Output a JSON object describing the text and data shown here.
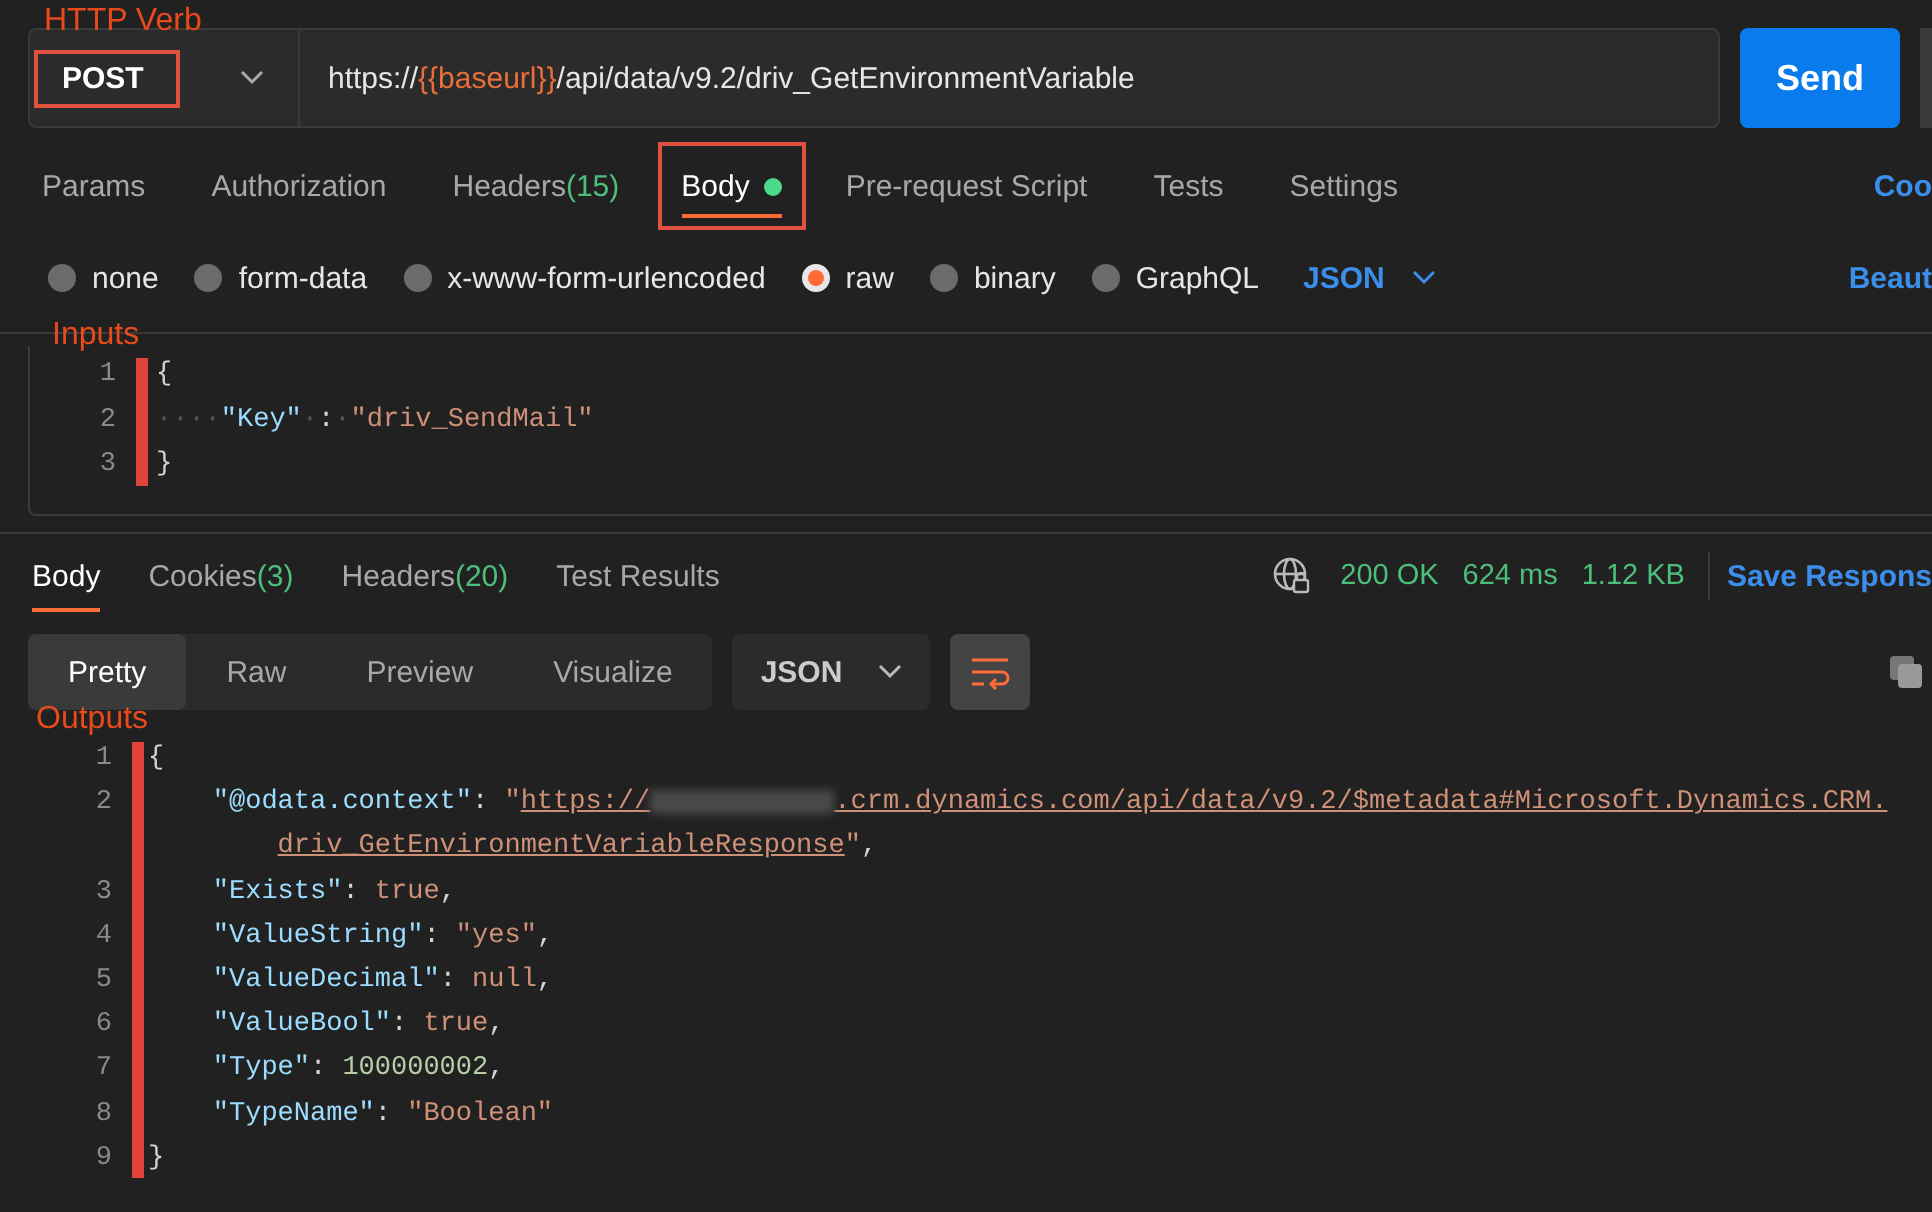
{
  "annotations": [
    {
      "text": "HTTP Verb"
    },
    {
      "text": "Inputs"
    },
    {
      "text": "Outputs"
    }
  ],
  "request": {
    "method": {
      "label": "POST",
      "highlighted": true
    },
    "url": [
      {
        "kind": "text",
        "text": "https://"
      },
      {
        "kind": "variable",
        "text": "{{baseurl}}"
      },
      {
        "kind": "text",
        "text": "/api/data/v9.2/driv_GetEnvironmentVariable"
      }
    ],
    "send_button": "Send"
  },
  "request_tabs": [
    {
      "label": "Params",
      "selected": false,
      "highlighted": false
    },
    {
      "label": "Authorization",
      "selected": false,
      "highlighted": false
    },
    {
      "label": "Headers",
      "count": "(15)",
      "selected": false,
      "highlighted": false
    },
    {
      "label": "Body",
      "selected": true,
      "highlighted": true,
      "dot": true
    },
    {
      "label": "Pre-request Script",
      "selected": false,
      "highlighted": false
    },
    {
      "label": "Tests",
      "selected": false,
      "highlighted": false
    },
    {
      "label": "Settings",
      "selected": false,
      "highlighted": false
    }
  ],
  "cookies_link": "Coo",
  "body_types": [
    {
      "label": "none",
      "selected": false
    },
    {
      "label": "form-data",
      "selected": false
    },
    {
      "label": "x-www-form-urlencoded",
      "selected": false
    },
    {
      "label": "raw",
      "selected": true
    },
    {
      "label": "binary",
      "selected": false
    },
    {
      "label": "GraphQL",
      "selected": false
    }
  ],
  "body_format": "JSON",
  "beautify_link": "Beaut",
  "request_body": [
    {
      "number": "1",
      "tokens": [
        {
          "kind": "punct",
          "text": "{"
        }
      ]
    },
    {
      "number": "2",
      "tokens": [
        {
          "kind": "indent",
          "text": "····"
        },
        {
          "kind": "key",
          "text": "\"Key\""
        },
        {
          "kind": "indent",
          "text": "·"
        },
        {
          "kind": "punct",
          "text": ":"
        },
        {
          "kind": "indent",
          "text": "·"
        },
        {
          "kind": "string",
          "text": "\"driv_SendMail\""
        }
      ]
    },
    {
      "number": "3",
      "tokens": [
        {
          "kind": "punct",
          "text": "}"
        }
      ]
    }
  ],
  "response_tabs": [
    {
      "label": "Body",
      "selected": true
    },
    {
      "label": "Cookies",
      "count": "(3)",
      "selected": false
    },
    {
      "label": "Headers",
      "count": "(20)",
      "selected": false
    },
    {
      "label": "Test Results",
      "selected": false
    }
  ],
  "status": {
    "code": "200 OK",
    "time": "624 ms",
    "size": "1.12 KB"
  },
  "save_response": "Save Respons",
  "view_modes": [
    {
      "label": "Pretty",
      "selected": true
    },
    {
      "label": "Raw",
      "selected": false
    },
    {
      "label": "Preview",
      "selected": false
    },
    {
      "label": "Visualize",
      "selected": false
    }
  ],
  "response_format": "JSON",
  "response_body": [
    {
      "number": "1",
      "tokens": [
        {
          "kind": "punct",
          "text": "{"
        }
      ]
    },
    {
      "number": "2",
      "indented": true,
      "tokens": [
        {
          "kind": "key",
          "text": "\"@odata.context\""
        },
        {
          "kind": "punct",
          "text": ": "
        },
        {
          "kind": "string",
          "text": "\""
        },
        {
          "kind": "link",
          "text": "https://"
        },
        {
          "kind": "redacted"
        },
        {
          "kind": "link",
          "text": ".crm.dynamics.com/api/data/v9.2/$metadata#Microsoft.Dynamics.CRM."
        }
      ]
    },
    {
      "continuation": true,
      "tokens": [
        {
          "kind": "link",
          "text": "driv_GetEnvironmentVariableResponse"
        },
        {
          "kind": "string",
          "text": "\""
        },
        {
          "kind": "punct",
          "text": ","
        }
      ]
    },
    {
      "number": "3",
      "indented": true,
      "tokens": [
        {
          "kind": "key",
          "text": "\"Exists\""
        },
        {
          "kind": "punct",
          "text": ": "
        },
        {
          "kind": "bool",
          "text": "true"
        },
        {
          "kind": "punct",
          "text": ","
        }
      ]
    },
    {
      "number": "4",
      "indented": true,
      "tokens": [
        {
          "kind": "key",
          "text": "\"ValueString\""
        },
        {
          "kind": "punct",
          "text": ": "
        },
        {
          "kind": "string",
          "text": "\"yes\""
        },
        {
          "kind": "punct",
          "text": ","
        }
      ]
    },
    {
      "number": "5",
      "indented": true,
      "tokens": [
        {
          "kind": "key",
          "text": "\"ValueDecimal\""
        },
        {
          "kind": "punct",
          "text": ": "
        },
        {
          "kind": "bool",
          "text": "null"
        },
        {
          "kind": "punct",
          "text": ","
        }
      ]
    },
    {
      "number": "6",
      "indented": true,
      "tokens": [
        {
          "kind": "key",
          "text": "\"ValueBool\""
        },
        {
          "kind": "punct",
          "text": ": "
        },
        {
          "kind": "bool",
          "text": "true"
        },
        {
          "kind": "punct",
          "text": ","
        }
      ]
    },
    {
      "number": "7",
      "indented": true,
      "tokens": [
        {
          "kind": "key",
          "text": "\"Type\""
        },
        {
          "kind": "punct",
          "text": ": "
        },
        {
          "kind": "number",
          "text": "100000002"
        },
        {
          "kind": "punct",
          "text": ","
        }
      ]
    },
    {
      "number": "8",
      "indented": true,
      "tokens": [
        {
          "kind": "key",
          "text": "\"TypeName\""
        },
        {
          "kind": "punct",
          "text": ": "
        },
        {
          "kind": "string",
          "text": "\"Boolean\""
        }
      ]
    },
    {
      "number": "9",
      "tokens": [
        {
          "kind": "punct",
          "text": "}"
        }
      ]
    }
  ]
}
